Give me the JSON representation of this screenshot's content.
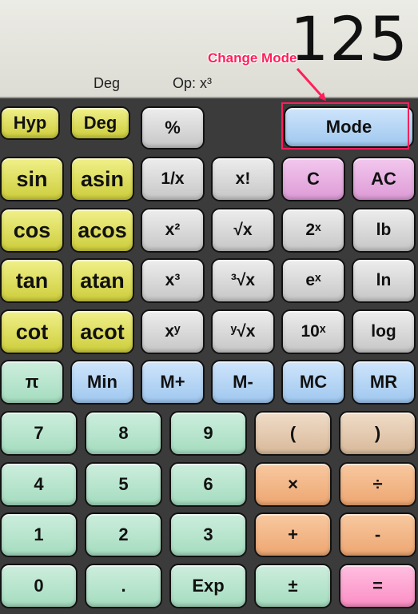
{
  "display": {
    "value": "125",
    "angle_mode": "Deg",
    "operation": "Op: x³"
  },
  "annotation": {
    "text": "Change Mode",
    "color": "#ff1f5a"
  },
  "buttons": {
    "hyp": "Hyp",
    "deg": "Deg",
    "percent": "%",
    "mode": "Mode",
    "sin": "sin",
    "asin": "asin",
    "reciprocal": "1/x",
    "factorial": "x!",
    "clear": "C",
    "all_clear": "AC",
    "cos": "cos",
    "acos": "acos",
    "square": "x²",
    "sqrt": "√x",
    "pow2": "2ˣ",
    "lb": "lb",
    "tan": "tan",
    "atan": "atan",
    "cube": "x³",
    "cbrt": "³√x",
    "exp_e": "eˣ",
    "ln": "ln",
    "cot": "cot",
    "acot": "acot",
    "power": "xʸ",
    "yroot": "ʸ√x",
    "pow10": "10ˣ",
    "log": "log",
    "pi": "π",
    "m_in": "Min",
    "m_plus": "M+",
    "m_minus": "M-",
    "m_clear": "MC",
    "m_recall": "MR",
    "d7": "7",
    "d8": "8",
    "d9": "9",
    "paren_open": "(",
    "paren_close": ")",
    "d4": "4",
    "d5": "5",
    "d6": "6",
    "multiply": "×",
    "divide": "÷",
    "d1": "1",
    "d2": "2",
    "d3": "3",
    "plus": "+",
    "minus": "-",
    "d0": "0",
    "decimal": ".",
    "exp": "Exp",
    "plus_minus": "±",
    "equals": "="
  }
}
